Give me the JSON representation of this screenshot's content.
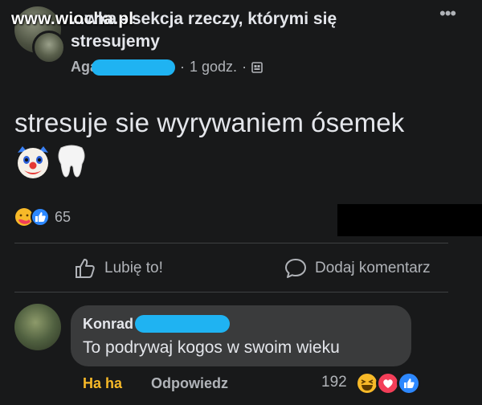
{
  "watermark": "www.wiocha.pl",
  "post": {
    "group_title": "...wka - sekcja rzeczy, którymi się stresujemy",
    "author_name": "Agata",
    "time": "1 godz.",
    "separator": "·",
    "more_label": "•••",
    "text": "stresuje sie wyrywaniem ósemek",
    "emojis": [
      "clown-face-icon",
      "tooth-icon"
    ],
    "reaction_icons": [
      "care-icon",
      "like-icon"
    ],
    "reaction_count": "65"
  },
  "actions": {
    "like_label": "Lubię to!",
    "comment_label": "Dodaj komentarz"
  },
  "comment": {
    "author": "Konrad",
    "text": "To podrywaj kogos w swoim wieku",
    "haha_label": "Ha ha",
    "reply_label": "Odpowiedz",
    "reaction_count": "192",
    "reaction_icons": [
      "haha-icon",
      "love-icon",
      "like-icon"
    ]
  },
  "colors": {
    "background": "#18191a",
    "bubble": "#3a3b3c",
    "redaction": "#1fb3f2",
    "haha_yellow": "#f7b928",
    "like_blue": "#2d88ff",
    "love_red": "#f33e58"
  }
}
